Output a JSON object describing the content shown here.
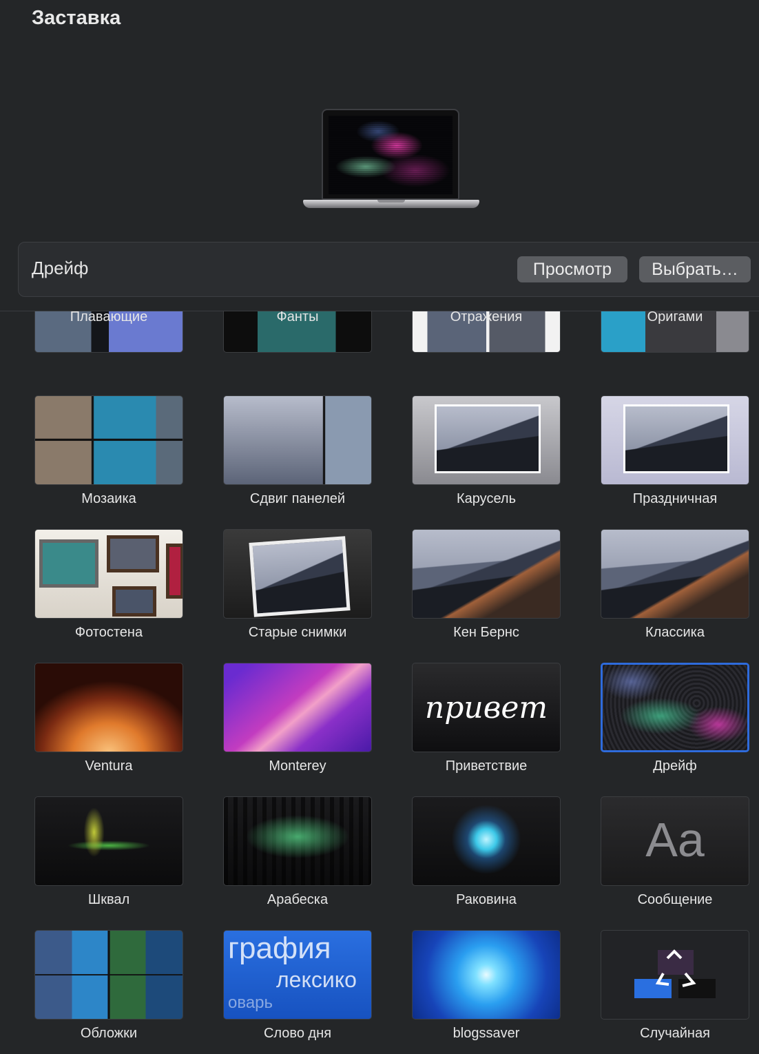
{
  "window": {
    "title": "Заставка"
  },
  "selection": {
    "current": "Дрейф",
    "preview_button": "Просмотр",
    "choose_button": "Выбрать…"
  },
  "screensavers": [
    {
      "label": "Плавающие"
    },
    {
      "label": "Фанты"
    },
    {
      "label": "Отражения"
    },
    {
      "label": "Оригами"
    },
    {
      "label": "Мозаика"
    },
    {
      "label": "Сдвиг панелей"
    },
    {
      "label": "Карусель"
    },
    {
      "label": "Праздничная"
    },
    {
      "label": "Фотостена"
    },
    {
      "label": "Старые снимки"
    },
    {
      "label": "Кен Бернс"
    },
    {
      "label": "Классика"
    },
    {
      "label": "Ventura"
    },
    {
      "label": "Monterey"
    },
    {
      "label": "Приветствие",
      "thumb_text": "привет"
    },
    {
      "label": "Дрейф",
      "selected": true
    },
    {
      "label": "Шквал"
    },
    {
      "label": "Арабеска"
    },
    {
      "label": "Раковина"
    },
    {
      "label": "Сообщение",
      "thumb_text": "Aa"
    },
    {
      "label": "Обложки"
    },
    {
      "label": "Слово дня",
      "thumb_text": [
        "графия",
        "лексико",
        "оварь"
      ]
    },
    {
      "label": "blogssaver"
    },
    {
      "label": "Случайная"
    }
  ],
  "colors": {
    "background": "#242628",
    "selection_border": "#2e6bdc",
    "button": "#5b5d61"
  }
}
